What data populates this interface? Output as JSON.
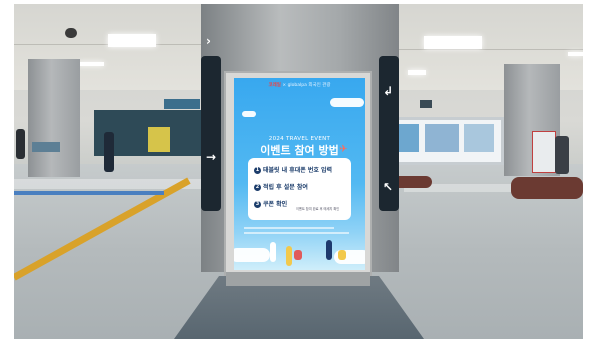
{
  "poster": {
    "brand_left": "코레일",
    "brand_right": "× globalpa 외국인 관광",
    "subtitle": "2024 TRAVEL EVENT",
    "title": "이벤트 참여 방법",
    "steps": [
      {
        "num": "1",
        "text": "태블릿 내 휴대폰 번호 입력"
      },
      {
        "num": "2",
        "text": "적립 후 설문 참여"
      },
      {
        "num": "3",
        "text": "쿠폰 확인"
      }
    ],
    "step3_note": "이벤트 참여 완료 후 메세지 확인"
  },
  "colors": {
    "poster_sky": "#53b9f2",
    "title_text": "#ffffff",
    "step_text": "#1c3d6b",
    "floor_line": "#d9a22a"
  }
}
